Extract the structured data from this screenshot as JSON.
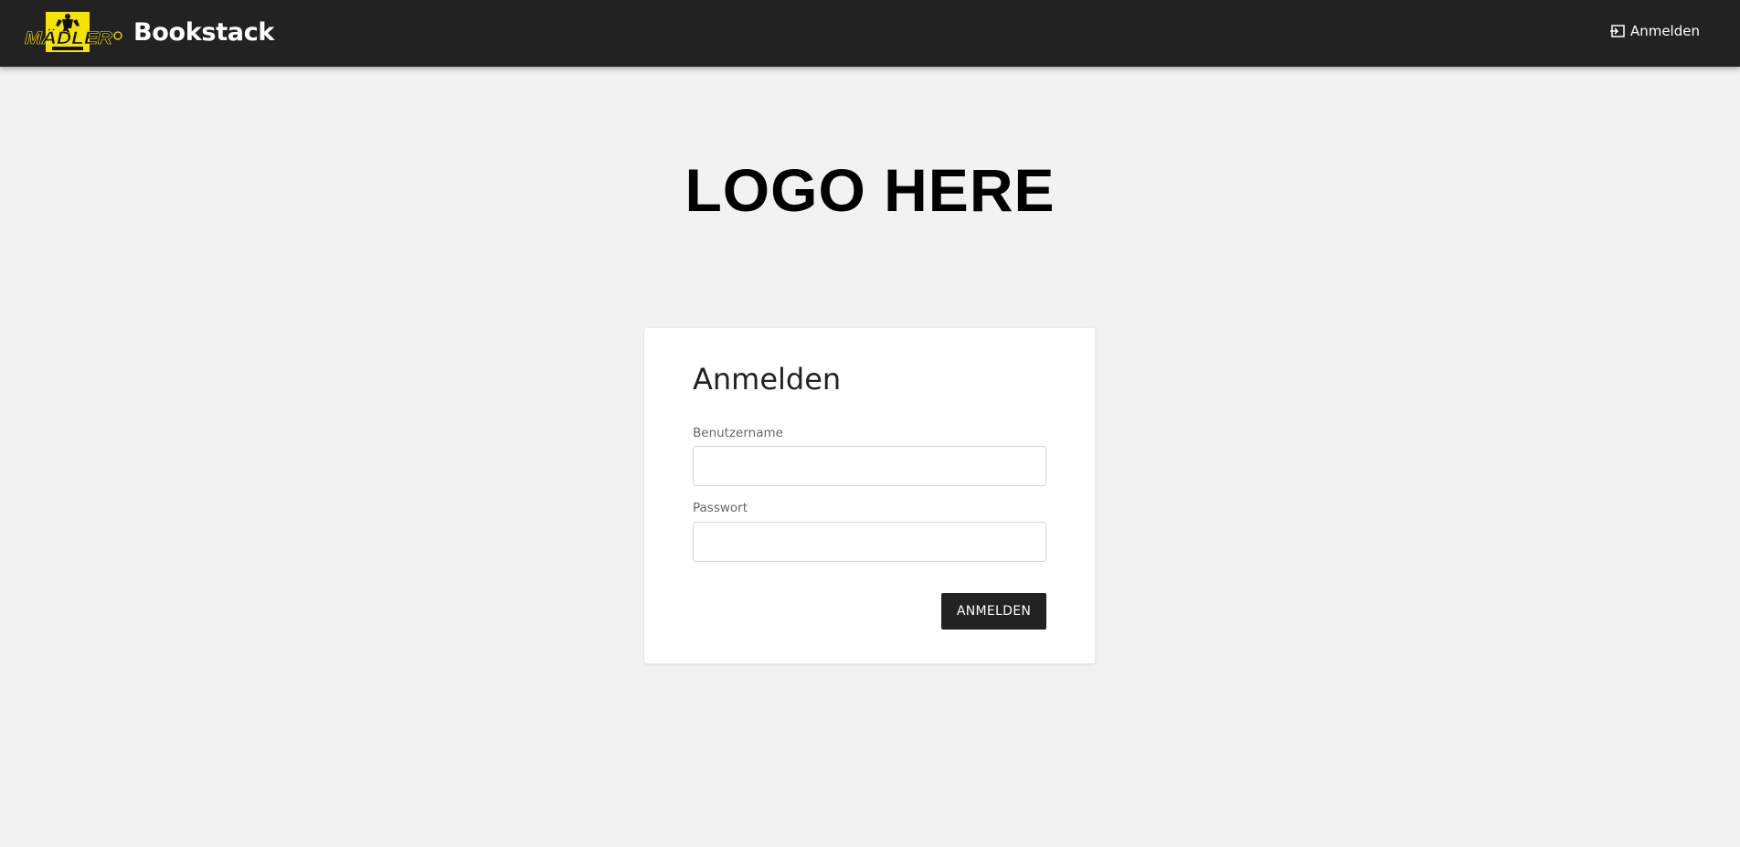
{
  "header": {
    "brand_logo": "madler-logo",
    "app_name": "Bookstack",
    "login_icon": "login-icon",
    "login_label": "Anmelden"
  },
  "site_logo_text": "LOGO HERE",
  "login_form": {
    "title": "Anmelden",
    "username_label": "Benutzername",
    "username_value": "",
    "password_label": "Passwort",
    "password_value": "",
    "submit_label": "ANMELDEN"
  },
  "colors": {
    "header_bg": "#222222",
    "page_bg": "#f2f2f2",
    "card_bg": "#ffffff",
    "button_bg": "#222222",
    "logo_yellow": "#f5e400"
  }
}
